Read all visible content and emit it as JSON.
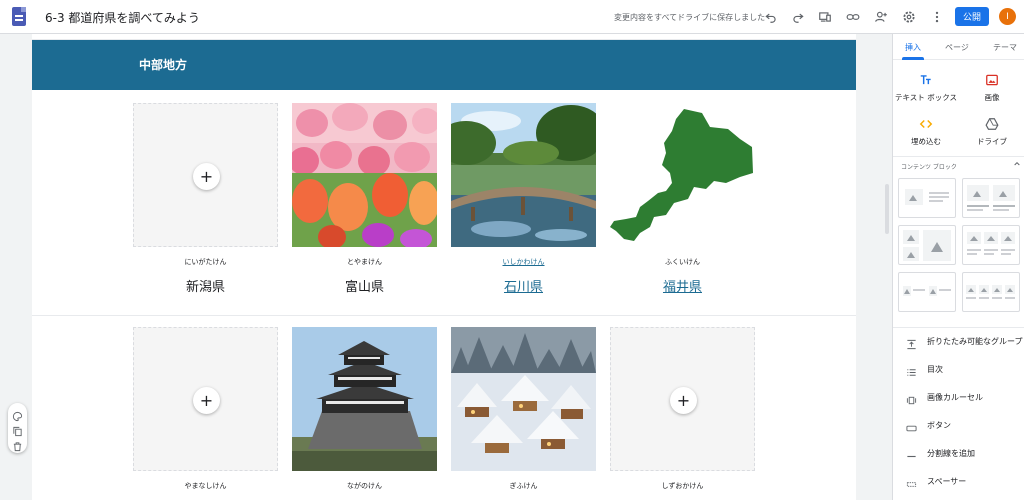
{
  "header": {
    "title": "6-3 都道府県を調べてみよう",
    "save_status": "変更内容をすべてドライブに保存しました",
    "publish_label": "公開",
    "avatar_initial": "I",
    "icons": [
      "undo-icon",
      "redo-icon",
      "preview-icon",
      "link-icon",
      "share-icon",
      "settings-icon",
      "more-icon"
    ]
  },
  "section": {
    "title": "中部地方",
    "color": "#1c6b92"
  },
  "row1": [
    {
      "kana": "にいがたけん",
      "name": "新潟県",
      "image": "placeholder",
      "linked": false
    },
    {
      "kana": "とやまけん",
      "name": "富山県",
      "image": "tulips",
      "linked": false
    },
    {
      "kana": "いしかわけん",
      "name": "石川県",
      "image": "garden-bridge",
      "linked": true
    },
    {
      "kana": "ふくいけん",
      "name": "福井県",
      "image": "map-shape",
      "linked": true
    }
  ],
  "row2": [
    {
      "kana": "やまなしけん",
      "image": "placeholder"
    },
    {
      "kana": "ながのけん",
      "image": "castle"
    },
    {
      "kana": "ぎふけん",
      "image": "snow-village"
    },
    {
      "kana": "しずおかけん",
      "image": "placeholder"
    }
  ],
  "panel": {
    "tabs": [
      "挿入",
      "ページ",
      "テーマ"
    ],
    "active_tab": "挿入",
    "insert": [
      {
        "label": "テキスト ボックス",
        "icon": "text-box-icon"
      },
      {
        "label": "画像",
        "icon": "image-icon"
      },
      {
        "label": "埋め込む",
        "icon": "embed-icon"
      },
      {
        "label": "ドライブ",
        "icon": "drive-icon"
      }
    ],
    "content_blocks_title": "コンテンツ ブロック",
    "elements": [
      {
        "label": "折りたたみ可能なグループ",
        "icon": "collapsible-icon"
      },
      {
        "label": "目次",
        "icon": "toc-icon"
      },
      {
        "label": "画像カルーセル",
        "icon": "carousel-icon"
      },
      {
        "label": "ボタン",
        "icon": "button-icon"
      },
      {
        "label": "分割線を追加",
        "icon": "divider-icon"
      },
      {
        "label": "スペーサー",
        "icon": "spacer-icon"
      }
    ]
  },
  "plus_symbol": "+",
  "colors": {
    "accent": "#1a73e8",
    "avatar": "#e8710a",
    "map_green": "#2e7d32"
  }
}
